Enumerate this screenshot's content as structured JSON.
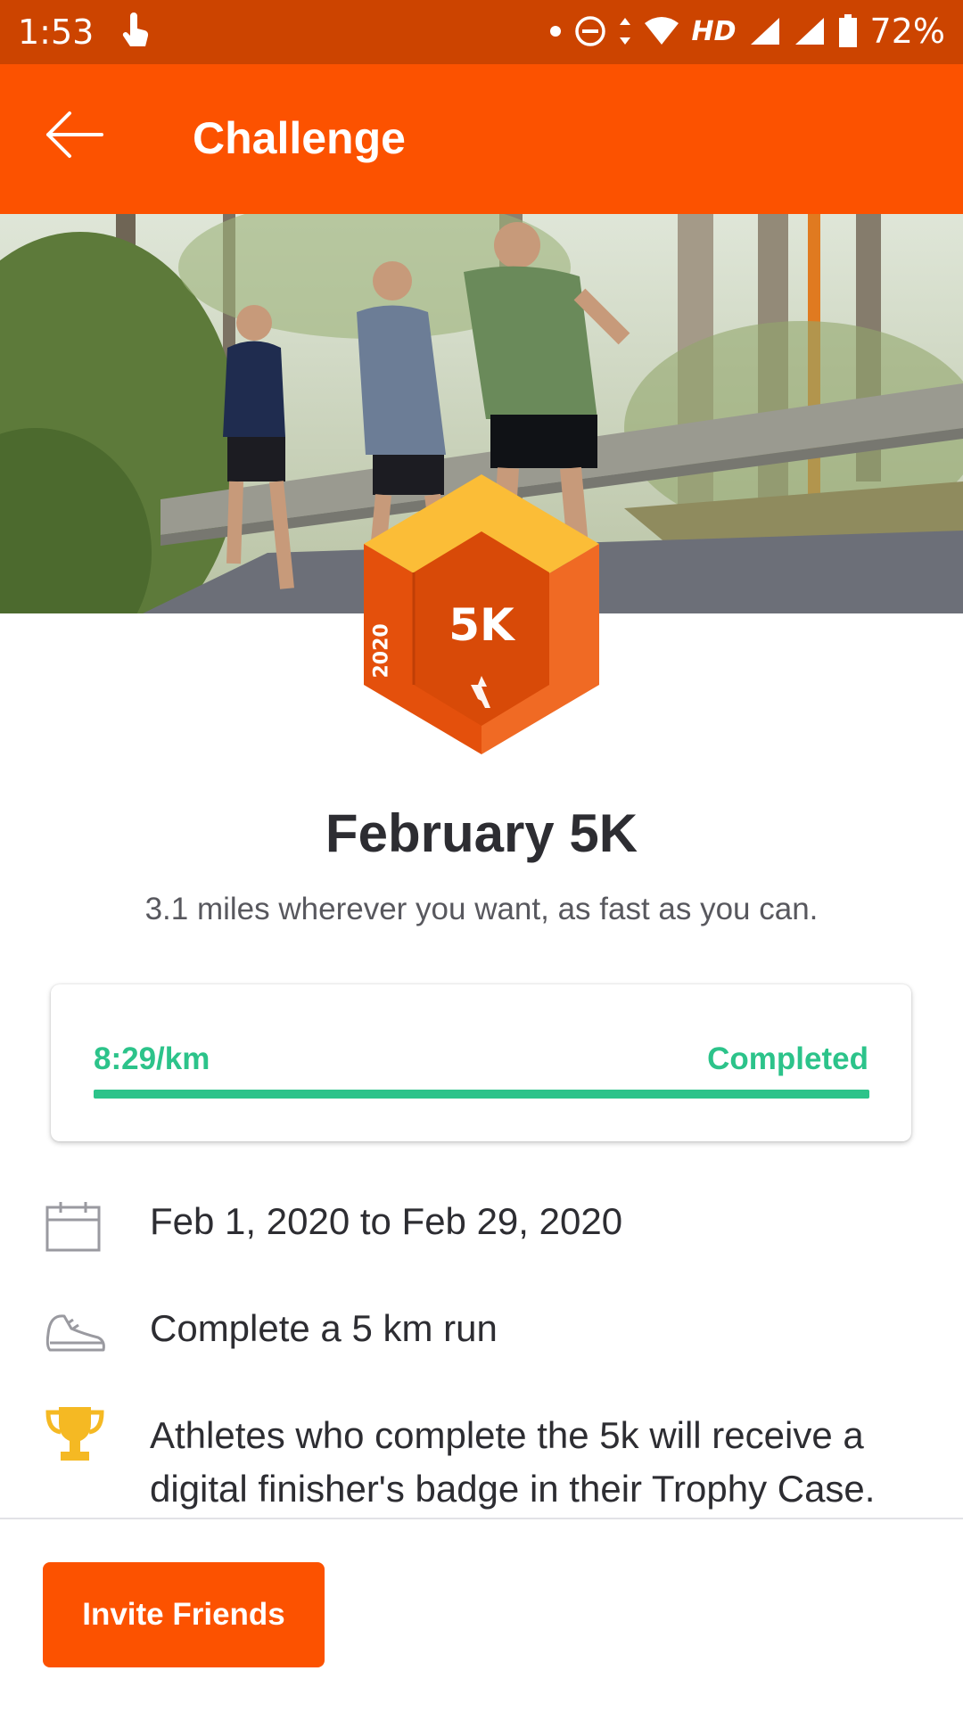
{
  "status_bar": {
    "time": "1:53",
    "network": "HD",
    "battery": "72%",
    "icons": [
      "touch-icon",
      "dot-icon",
      "do-not-disturb-icon",
      "data-arrows-icon",
      "wifi-icon",
      "signal-icon",
      "signal-icon",
      "battery-icon"
    ]
  },
  "app_bar": {
    "title": "Challenge",
    "back_icon": "arrow-left-icon"
  },
  "badge": {
    "year": "2020",
    "distance": "5K"
  },
  "challenge": {
    "title": "February 5K",
    "subtitle": "3.1 miles wherever you want, as fast as you can."
  },
  "progress": {
    "pace": "8:29/km",
    "status": "Completed",
    "fraction": 1.0
  },
  "details": [
    {
      "icon": "calendar-icon",
      "text": "Feb 1, 2020 to Feb 29, 2020"
    },
    {
      "icon": "shoe-icon",
      "text": "Complete a 5 km run"
    },
    {
      "icon": "trophy-icon",
      "text": "Athletes who complete the 5k will receive a digital finisher's badge in their Trophy Case."
    }
  ],
  "actions": {
    "invite_label": "Invite Friends"
  },
  "colors": {
    "brand": "#fc5200",
    "status_bar": "#cc4400",
    "success": "#2cc38a",
    "trophy": "#f5b923"
  }
}
